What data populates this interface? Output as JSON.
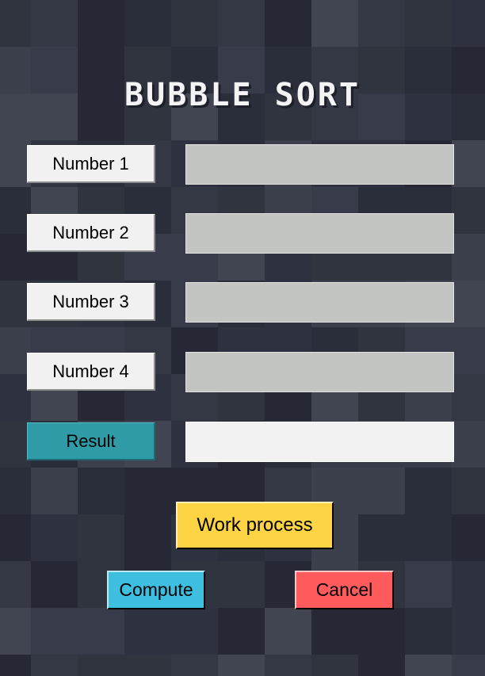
{
  "title": "BUBBLE SORT",
  "rows": [
    {
      "label": "Number 1",
      "value": ""
    },
    {
      "label": "Number 2",
      "value": ""
    },
    {
      "label": "Number 3",
      "value": ""
    },
    {
      "label": "Number 4",
      "value": ""
    }
  ],
  "result": {
    "label": "Result",
    "value": ""
  },
  "buttons": {
    "work_process": "Work process",
    "compute": "Compute",
    "cancel": "Cancel"
  },
  "colors": {
    "background": "#2d3140",
    "input_fill": "#c3c5c2",
    "result_label": "#2e9ba6",
    "result_field": "#f2f2f2",
    "work_process": "#fdd444",
    "compute": "#3ebfe0",
    "cancel": "#ff5a5c"
  }
}
